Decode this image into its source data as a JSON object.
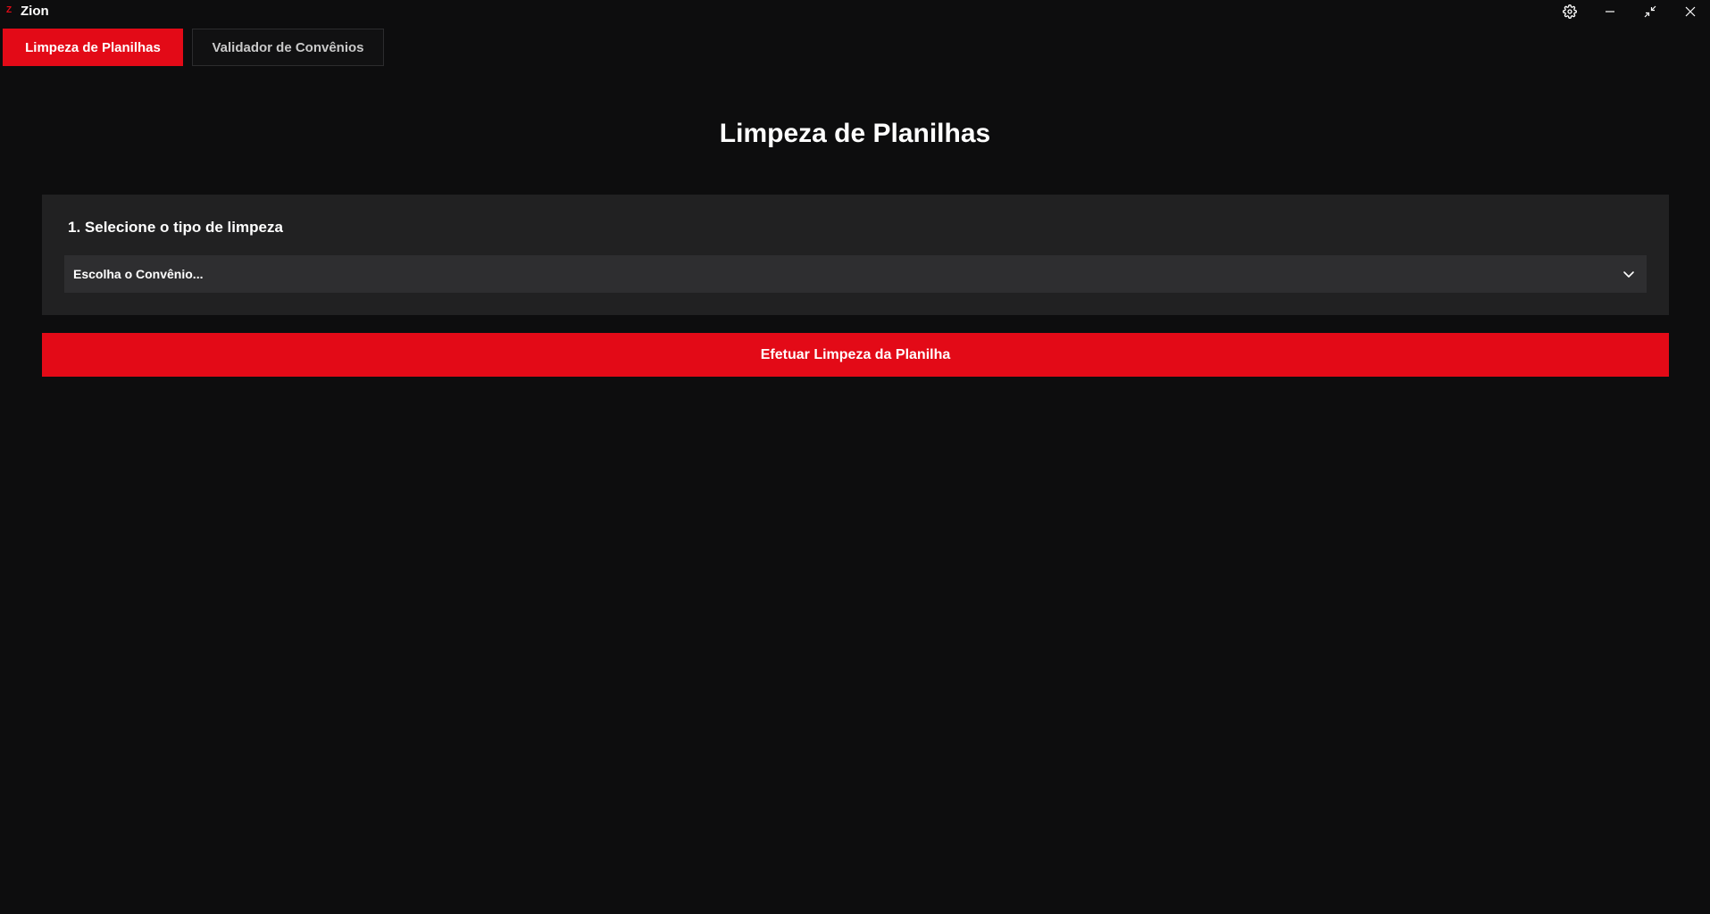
{
  "window": {
    "logo_text": "Z",
    "title": "Zion",
    "controls": [
      {
        "name": "gear-icon"
      },
      {
        "name": "minimize-icon"
      },
      {
        "name": "restore-icon"
      },
      {
        "name": "close-icon"
      }
    ]
  },
  "tabs": [
    {
      "label": "Limpeza de Planilhas",
      "active": true
    },
    {
      "label": "Validador de Convênios",
      "active": false
    }
  ],
  "main": {
    "title": "Limpeza de Planilhas",
    "section": {
      "label": "1. Selecione o tipo de limpeza",
      "select": {
        "value": "Escolha o Convênio..."
      }
    },
    "action_label": "Efetuar Limpeza da Planilha"
  },
  "colors": {
    "accent": "#e30a17",
    "background": "#0d0d0e",
    "panel": "#212122",
    "select": "#2e2e30"
  }
}
